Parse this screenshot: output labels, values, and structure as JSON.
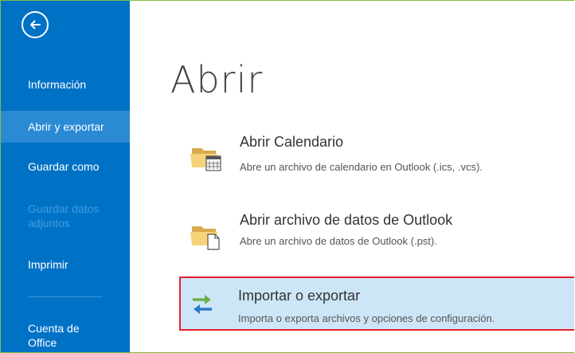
{
  "sidebar": {
    "items": [
      {
        "label": "Información",
        "state": "normal"
      },
      {
        "label": "Abrir y exportar",
        "state": "active"
      },
      {
        "label": "Guardar como",
        "state": "normal"
      },
      {
        "label": "Guardar datos adjuntos",
        "state": "disabled"
      },
      {
        "label": "Imprimir",
        "state": "normal"
      },
      {
        "label": "Cuenta de Office",
        "state": "normal"
      }
    ]
  },
  "main": {
    "title": "Abrir",
    "options": [
      {
        "title": "Abrir Calendario",
        "description": "Abre un archivo de calendario en Outlook (.ics, .vcs).",
        "icon": "folder-calendar-icon"
      },
      {
        "title": "Abrir archivo de datos de Outlook",
        "description": "Abre un archivo de datos de Outlook (.pst).",
        "icon": "folder-file-icon"
      },
      {
        "title": "Importar o exportar",
        "description": "Importa o exporta archivos y opciones de configuración.",
        "icon": "import-export-arrows-icon",
        "selected": true
      }
    ]
  },
  "colors": {
    "sidebar": "#0072c6",
    "sidebar_active": "#2a8ad4",
    "selected_bg": "#cde6f7",
    "highlight_border": "#e3202b"
  }
}
